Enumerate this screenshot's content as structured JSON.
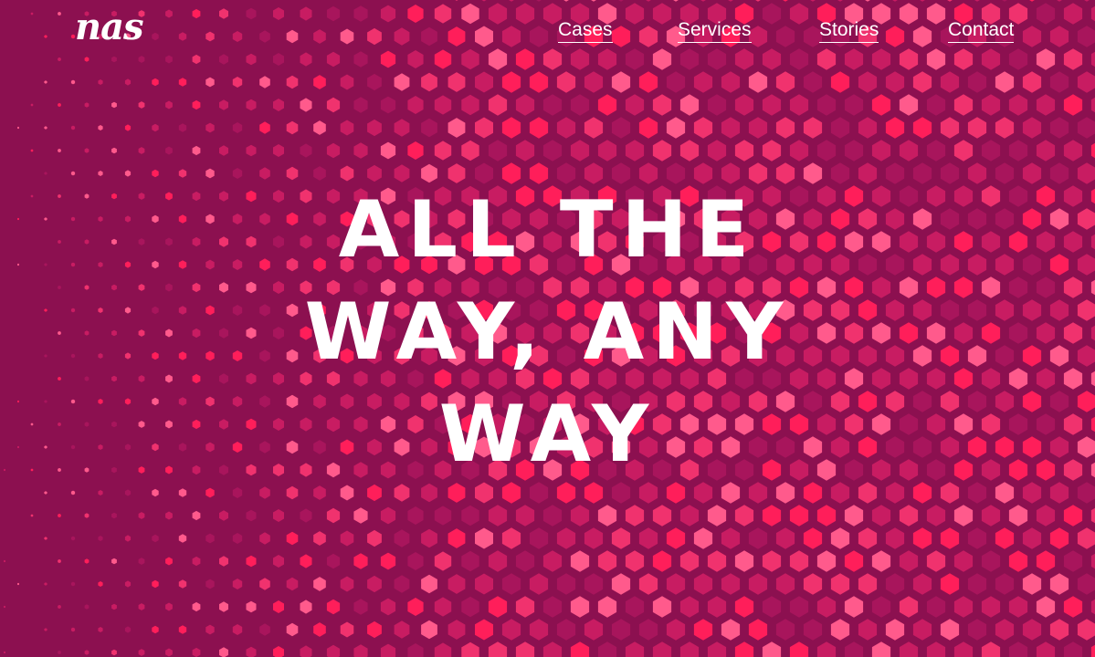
{
  "brand": {
    "logo_text": "nas"
  },
  "nav": {
    "items": [
      {
        "label": "Cases"
      },
      {
        "label": "Services"
      },
      {
        "label": "Stories"
      },
      {
        "label": "Contact"
      }
    ]
  },
  "hero": {
    "lines": [
      "ALL THE",
      "WAY, ANY",
      "WAY"
    ]
  },
  "colors": {
    "background": "#8c1050",
    "hex_deep": "#a8155c",
    "hex_mid": "#c81c62",
    "hex_hot": "#f0326e",
    "hex_bright": "#ff1e5a",
    "hex_light": "#ff5a8c",
    "text": "#ffffff"
  }
}
